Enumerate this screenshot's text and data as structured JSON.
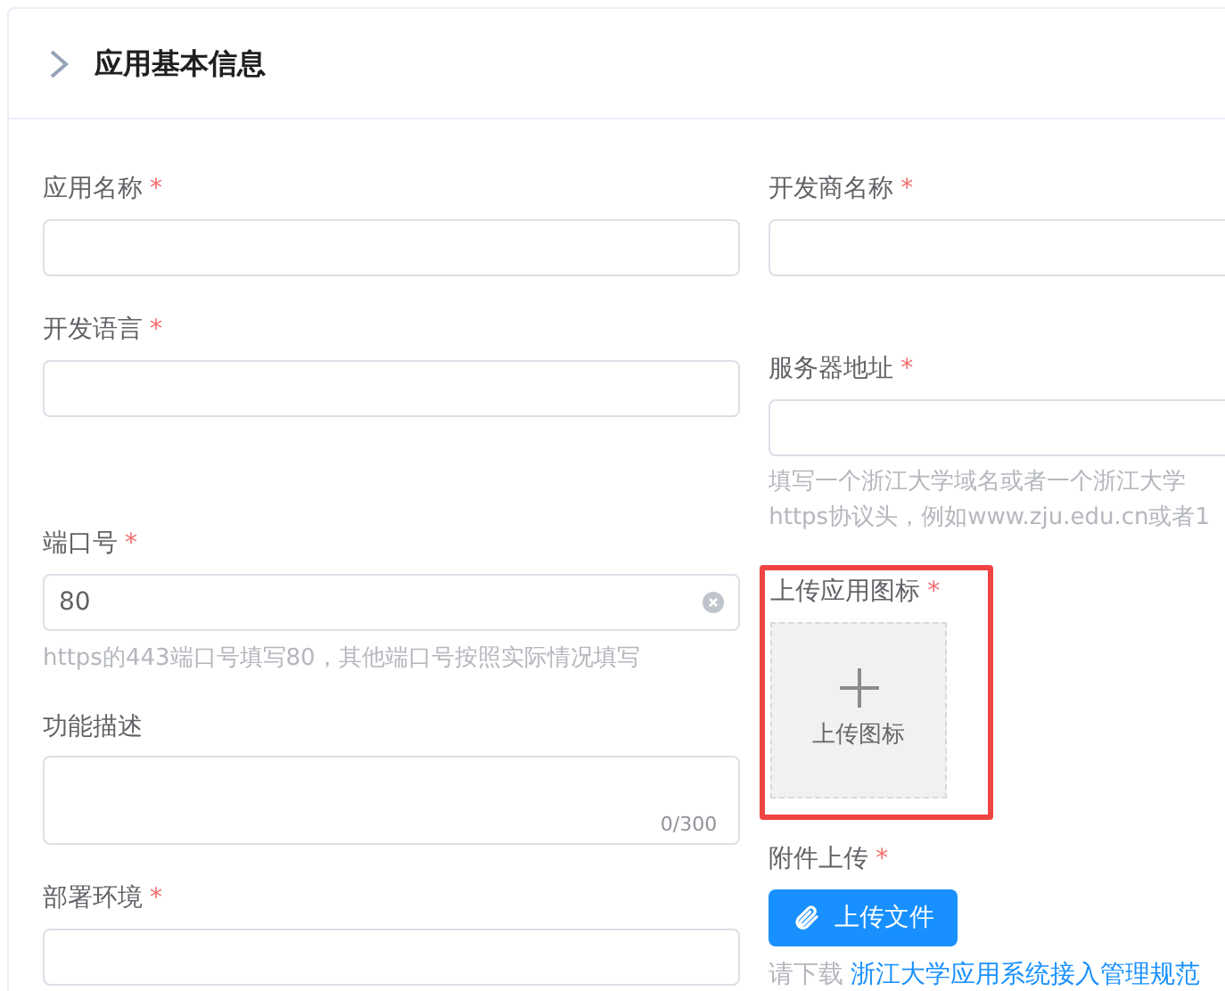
{
  "section": {
    "title": "应用基本信息",
    "expanded": false
  },
  "left_fields": [
    {
      "kind": "input",
      "label": "应用名称",
      "required_mark": "*"
    },
    {
      "kind": "input",
      "label": "开发语言",
      "required_mark": "*"
    },
    {
      "kind": "input",
      "label": "端口号",
      "required_mark": "*",
      "value": "80",
      "clearable": true,
      "hint": "https的443端口号填写80，其他端口号按照实际情况填写"
    },
    {
      "kind": "textarea",
      "label": "功能描述",
      "counter": "0/300"
    },
    {
      "kind": "input",
      "label": "部署环境",
      "required_mark": "*"
    }
  ],
  "right_fields": [
    {
      "kind": "input",
      "label": "开发商名称",
      "required_mark": "*"
    },
    {
      "kind": "input",
      "label": "服务器地址",
      "required_mark": "*",
      "hint_lines": [
        "填写一个浙江大学域名或者一个浙江大学",
        "https协议头，例如www.zju.edu.cn或者1"
      ]
    },
    {
      "kind": "image_upload",
      "label": "上传应用图标",
      "required_mark": "*",
      "highlighted": true,
      "upload_text": "上传图标"
    },
    {
      "kind": "file_upload",
      "label": "附件上传",
      "required_mark": "*",
      "button": "上传文件",
      "note": "请下载",
      "link": "浙江大学应用系统接入管理规范"
    }
  ]
}
